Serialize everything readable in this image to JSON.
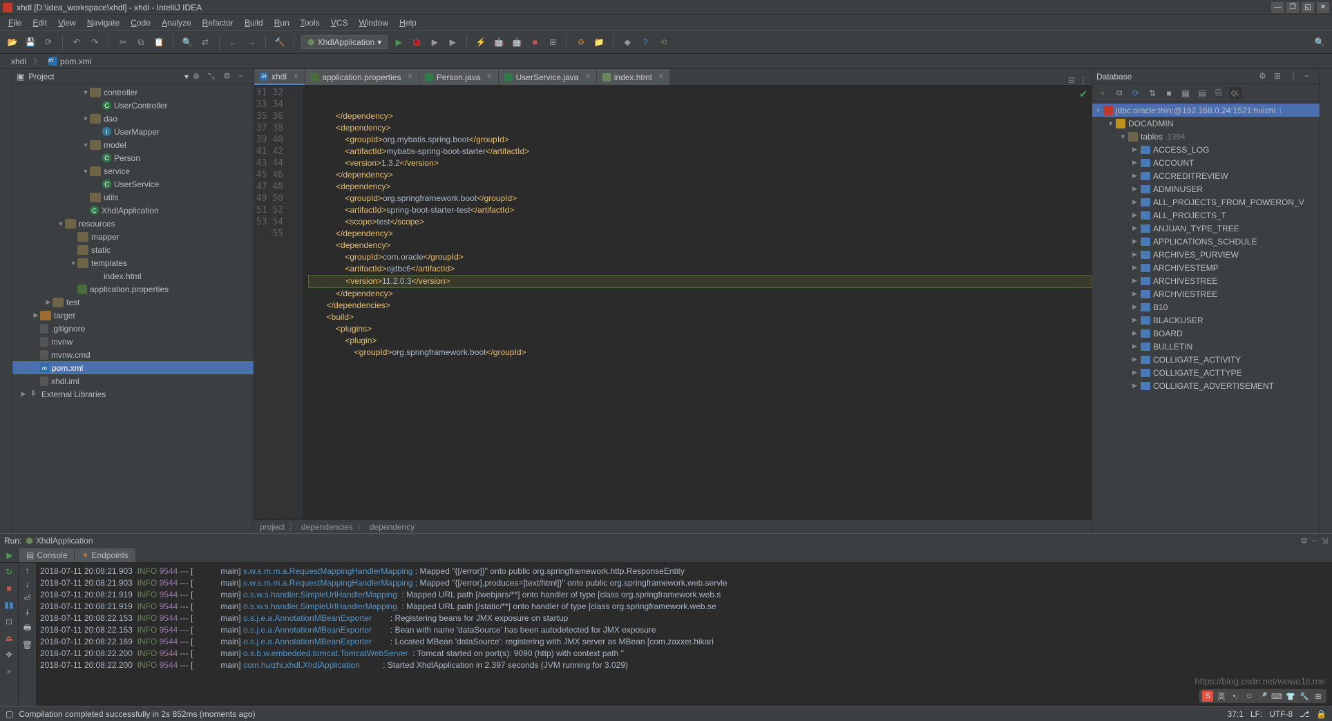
{
  "window": {
    "title": "xhdl [D:\\idea_workspace\\xhdl] - xhdl - IntelliJ IDEA"
  },
  "menu": [
    "File",
    "Edit",
    "View",
    "Navigate",
    "Code",
    "Analyze",
    "Refactor",
    "Build",
    "Run",
    "Tools",
    "VCS",
    "Window",
    "Help"
  ],
  "runConfig": "XhdlApplication",
  "breadcrumb": [
    {
      "icon": "folder-blue",
      "label": "xhdl"
    },
    {
      "icon": "m",
      "label": "pom.xml"
    }
  ],
  "projectPane": {
    "title": "Project"
  },
  "tree": [
    {
      "d": 5,
      "arrow": "▼",
      "ico": "folder",
      "label": "controller"
    },
    {
      "d": 6,
      "arrow": "",
      "ico": "circle-c",
      "label": "UserController"
    },
    {
      "d": 5,
      "arrow": "▼",
      "ico": "folder",
      "label": "dao"
    },
    {
      "d": 6,
      "arrow": "",
      "ico": "circle-i",
      "label": "UserMapper"
    },
    {
      "d": 5,
      "arrow": "▼",
      "ico": "folder",
      "label": "model"
    },
    {
      "d": 6,
      "arrow": "",
      "ico": "circle-c",
      "label": "Person"
    },
    {
      "d": 5,
      "arrow": "▼",
      "ico": "folder",
      "label": "service"
    },
    {
      "d": 6,
      "arrow": "",
      "ico": "circle-c",
      "label": "UserService"
    },
    {
      "d": 5,
      "arrow": "",
      "ico": "folder",
      "label": "utils"
    },
    {
      "d": 5,
      "arrow": "",
      "ico": "circle-c",
      "label": "XhdlApplication"
    },
    {
      "d": 3,
      "arrow": "▼",
      "ico": "folder",
      "label": "resources"
    },
    {
      "d": 4,
      "arrow": "",
      "ico": "folder",
      "label": "mapper"
    },
    {
      "d": 4,
      "arrow": "",
      "ico": "folder",
      "label": "static"
    },
    {
      "d": 4,
      "arrow": "▼",
      "ico": "folder",
      "label": "templates"
    },
    {
      "d": 5,
      "arrow": "",
      "ico": "html",
      "label": "index.html"
    },
    {
      "d": 4,
      "arrow": "",
      "ico": "xml",
      "label": "application.properties"
    },
    {
      "d": 2,
      "arrow": "▶",
      "ico": "folder",
      "label": "test"
    },
    {
      "d": 1,
      "arrow": "▶",
      "ico": "folder-orange",
      "label": "target"
    },
    {
      "d": 1,
      "arrow": "",
      "ico": "file",
      "label": ".gitignore"
    },
    {
      "d": 1,
      "arrow": "",
      "ico": "file",
      "label": "mvnw"
    },
    {
      "d": 1,
      "arrow": "",
      "ico": "file",
      "label": "mvnw.cmd"
    },
    {
      "d": 1,
      "arrow": "",
      "ico": "m",
      "label": "pom.xml",
      "sel": true
    },
    {
      "d": 1,
      "arrow": "",
      "ico": "file",
      "label": "xhdl.iml"
    },
    {
      "d": 0,
      "arrow": "▶",
      "ico": "lib",
      "label": "External Libraries"
    }
  ],
  "editorTabs": [
    {
      "ico": "#2f6da8",
      "label": "xhdl",
      "active": true,
      "kind": "m"
    },
    {
      "ico": "#4a6b3a",
      "label": "application.properties"
    },
    {
      "ico": "#2f7a48",
      "label": "Person.java"
    },
    {
      "ico": "#2f7a48",
      "label": "UserService.java"
    },
    {
      "ico": "#6a8759",
      "label": "index.html"
    }
  ],
  "code": {
    "startLine": 31,
    "lines": [
      "            </dependency>",
      "            <dependency>",
      "                <groupId>org.mybatis.spring.boot</groupId>",
      "                <artifactId>mybatis-spring-boot-starter</artifactId>",
      "                <version>1.3.2</version>",
      "            </dependency>",
      "",
      "            <dependency>",
      "                <groupId>org.springframework.boot</groupId>",
      "                <artifactId>spring-boot-starter-test</artifactId>",
      "                <scope>test</scope>",
      "            </dependency>",
      "",
      "            <dependency>",
      "                <groupId>com.oracle</groupId>",
      "                <artifactId>ojdbc6</artifactId>",
      "                <version>11.2.0.3</version>",
      "            </dependency>",
      "",
      "        </dependencies>",
      "",
      "        <build>",
      "            <plugins>",
      "                <plugin>",
      "                    <groupId>org.springframework.boot</groupId>"
    ],
    "highlightLine": 47
  },
  "editorBreadcrumb": [
    "project",
    "dependencies",
    "dependency"
  ],
  "databasePane": {
    "title": "Database"
  },
  "dbConn": "jdbc:oracle:thin:@192.168.0.24:1521:huizhi",
  "dbSchema": "DOCADMIN",
  "dbTablesLabel": "tables",
  "dbTablesCount": "1394",
  "tables": [
    "ACCESS_LOG",
    "ACCOUNT",
    "ACCREDITREVIEW",
    "ADMINUSER",
    "ALL_PROJECTS_FROM_POWERON_V",
    "ALL_PROJECTS_T",
    "ANJUAN_TYPE_TREE",
    "APPLICATIONS_SCHDULE",
    "ARCHIVES_PURVIEW",
    "ARCHIVESTEMP",
    "ARCHIVESTREE",
    "ARCHVIESTREE",
    "B10",
    "BLACKUSER",
    "BOARD",
    "BULLETIN",
    "COLLIGATE_ACTIVITY",
    "COLLIGATE_ACTTYPE",
    "COLLIGATE_ADVERTISEMENT"
  ],
  "runTabTitle": "Run:",
  "runConfigName": "XhdlApplication",
  "consoleTabs": [
    "Console",
    "Endpoints"
  ],
  "logs": [
    {
      "ts": "2018-07-11 20:08:21.903",
      "lvl": "INFO",
      "pid": "9544",
      "thr": "main",
      "src": "s.w.s.m.m.a.RequestMappingHandlerMapping",
      "msg": "Mapped \"{[/error]}\" onto public org.springframework.http.ResponseEntity<java.util.M"
    },
    {
      "ts": "2018-07-11 20:08:21.903",
      "lvl": "INFO",
      "pid": "9544",
      "thr": "main",
      "src": "s.w.s.m.m.a.RequestMappingHandlerMapping",
      "msg": "Mapped \"{[/error],produces=[text/html]}\" onto public org.springframework.web.servle"
    },
    {
      "ts": "2018-07-11 20:08:21.919",
      "lvl": "INFO",
      "pid": "9544",
      "thr": "main",
      "src": "o.s.w.s.handler.SimpleUrlHandlerMapping",
      "msg": "Mapped URL path [/webjars/**] onto handler of type [class org.springframework.web.s"
    },
    {
      "ts": "2018-07-11 20:08:21.919",
      "lvl": "INFO",
      "pid": "9544",
      "thr": "main",
      "src": "o.s.w.s.handler.SimpleUrlHandlerMapping",
      "msg": "Mapped URL path [/static/**] onto handler of type [class org.springframework.web.se"
    },
    {
      "ts": "2018-07-11 20:08:22.153",
      "lvl": "INFO",
      "pid": "9544",
      "thr": "main",
      "src": "o.s.j.e.a.AnnotationMBeanExporter",
      "msg": "Registering beans for JMX exposure on startup"
    },
    {
      "ts": "2018-07-11 20:08:22.153",
      "lvl": "INFO",
      "pid": "9544",
      "thr": "main",
      "src": "o.s.j.e.a.AnnotationMBeanExporter",
      "msg": "Bean with name 'dataSource' has been autodetected for JMX exposure"
    },
    {
      "ts": "2018-07-11 20:08:22.169",
      "lvl": "INFO",
      "pid": "9544",
      "thr": "main",
      "src": "o.s.j.e.a.AnnotationMBeanExporter",
      "msg": "Located MBean 'dataSource': registering with JMX server as MBean [com.zaxxer.hikari"
    },
    {
      "ts": "2018-07-11 20:08:22.200",
      "lvl": "INFO",
      "pid": "9544",
      "thr": "main",
      "src": "o.s.b.w.embedded.tomcat.TomcatWebServer",
      "msg": "Tomcat started on port(s): 9090 (http) with context path ''"
    },
    {
      "ts": "2018-07-11 20:08:22.200",
      "lvl": "INFO",
      "pid": "9544",
      "thr": "main",
      "src": "com.huizhi.xhdl.XhdlApplication",
      "msg": "Started XhdlApplication in 2.397 seconds (JVM running for 3.029)"
    }
  ],
  "status": {
    "msg": "Compilation completed successfully in 2s 852ms (moments ago)",
    "pos": "37:1",
    "sep": "LF:",
    "enc": "UTF-8"
  },
  "watermark": "https://blog.csdn.net/wowo1ti.me"
}
